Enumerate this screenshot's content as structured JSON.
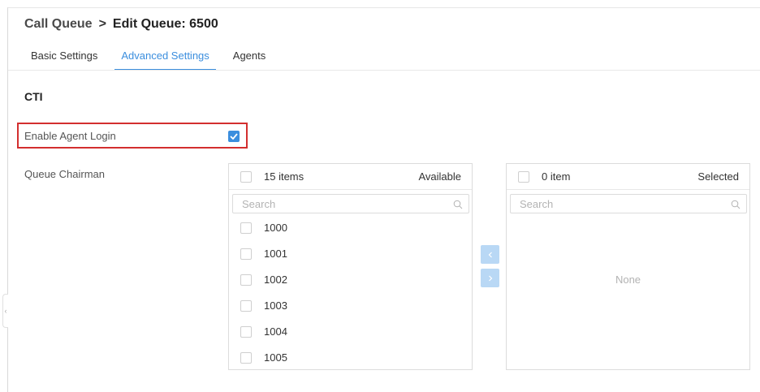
{
  "header": {
    "breadcrumb_parent": "Call Queue",
    "breadcrumb_separator": ">",
    "breadcrumb_current": "Edit Queue: 6500"
  },
  "tabs": [
    {
      "label": "Basic Settings",
      "active": false
    },
    {
      "label": "Advanced Settings",
      "active": true
    },
    {
      "label": "Agents",
      "active": false
    }
  ],
  "section": {
    "title": "CTI"
  },
  "fields": {
    "enable_agent_login": {
      "label": "Enable Agent Login",
      "checked": true
    },
    "queue_chairman": {
      "label": "Queue Chairman"
    }
  },
  "transfer": {
    "available": {
      "count_text": "15 items",
      "title": "Available",
      "search_placeholder": "Search",
      "items": [
        "1000",
        "1001",
        "1002",
        "1003",
        "1004",
        "1005"
      ]
    },
    "selected": {
      "count_text": "0 item",
      "title": "Selected",
      "search_placeholder": "Search",
      "empty_text": "None"
    },
    "icons": {
      "move_left": "chevron-left-icon",
      "move_right": "chevron-right-icon"
    }
  },
  "colors": {
    "accent": "#3b8ede",
    "highlight": "#d32f2f",
    "disabled_button": "#b9d8f5"
  }
}
